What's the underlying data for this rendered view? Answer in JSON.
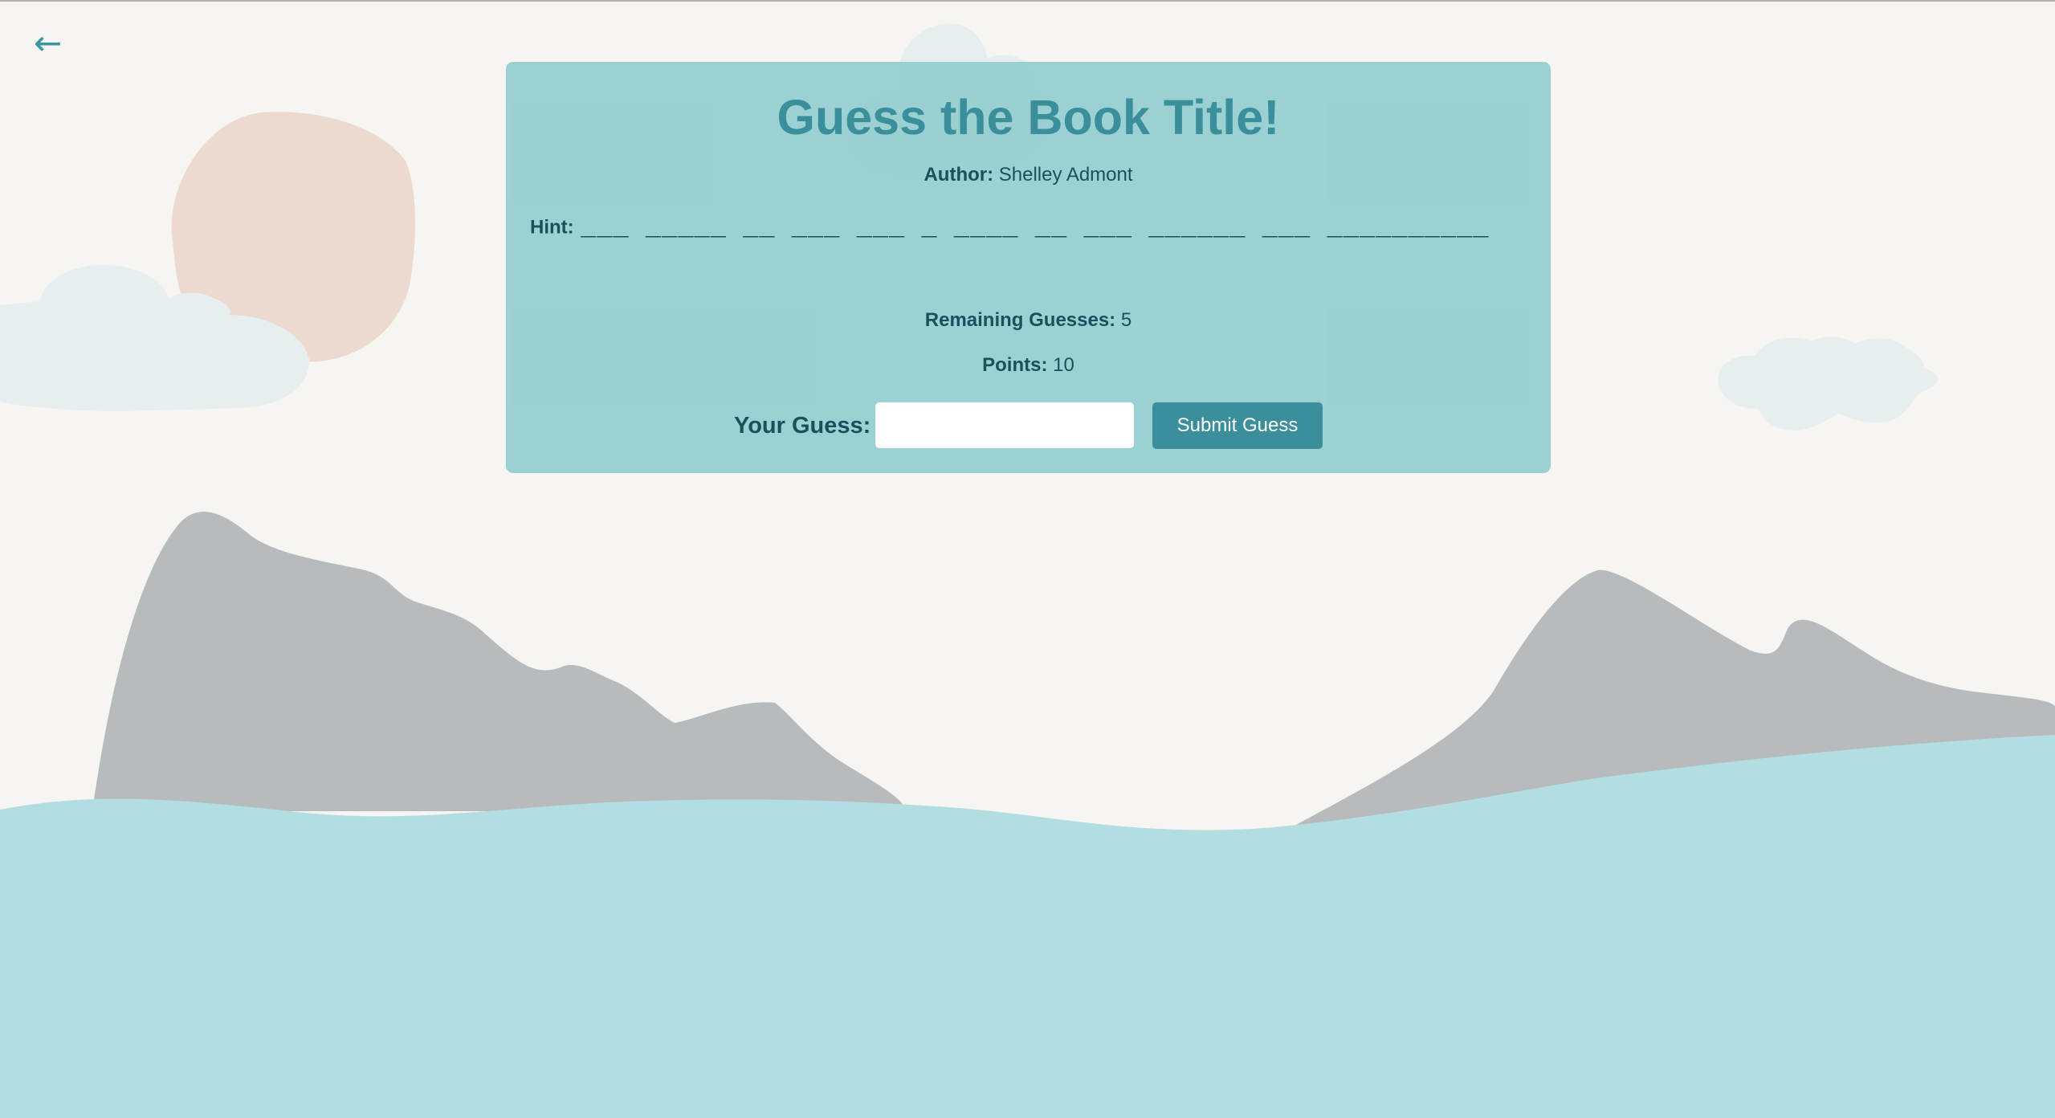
{
  "navigation": {
    "back_label": "←"
  },
  "game": {
    "title": "Guess the Book Title!",
    "author_label": "Author:",
    "author_value": "Shelley Admont",
    "hint_label": "Hint:",
    "hint_value": "___ _____ __ ___ ___ _ ____ __ ___ ______ ___ __________",
    "remaining_label": "Remaining Guesses:",
    "remaining_value": "5",
    "points_label": "Points:",
    "points_value": "10",
    "guess_label": "Your Guess:",
    "guess_value": "",
    "submit_label": "Submit Guess"
  },
  "colors": {
    "background": "#f7f5f2",
    "card": "#9ad0d3",
    "accent": "#3a8f9a",
    "text_dark": "#17525c",
    "mountains": "#b7bbbd",
    "water": "#b3dee1",
    "sun": "#ecd9cf",
    "clouds": "#e6eeef"
  }
}
